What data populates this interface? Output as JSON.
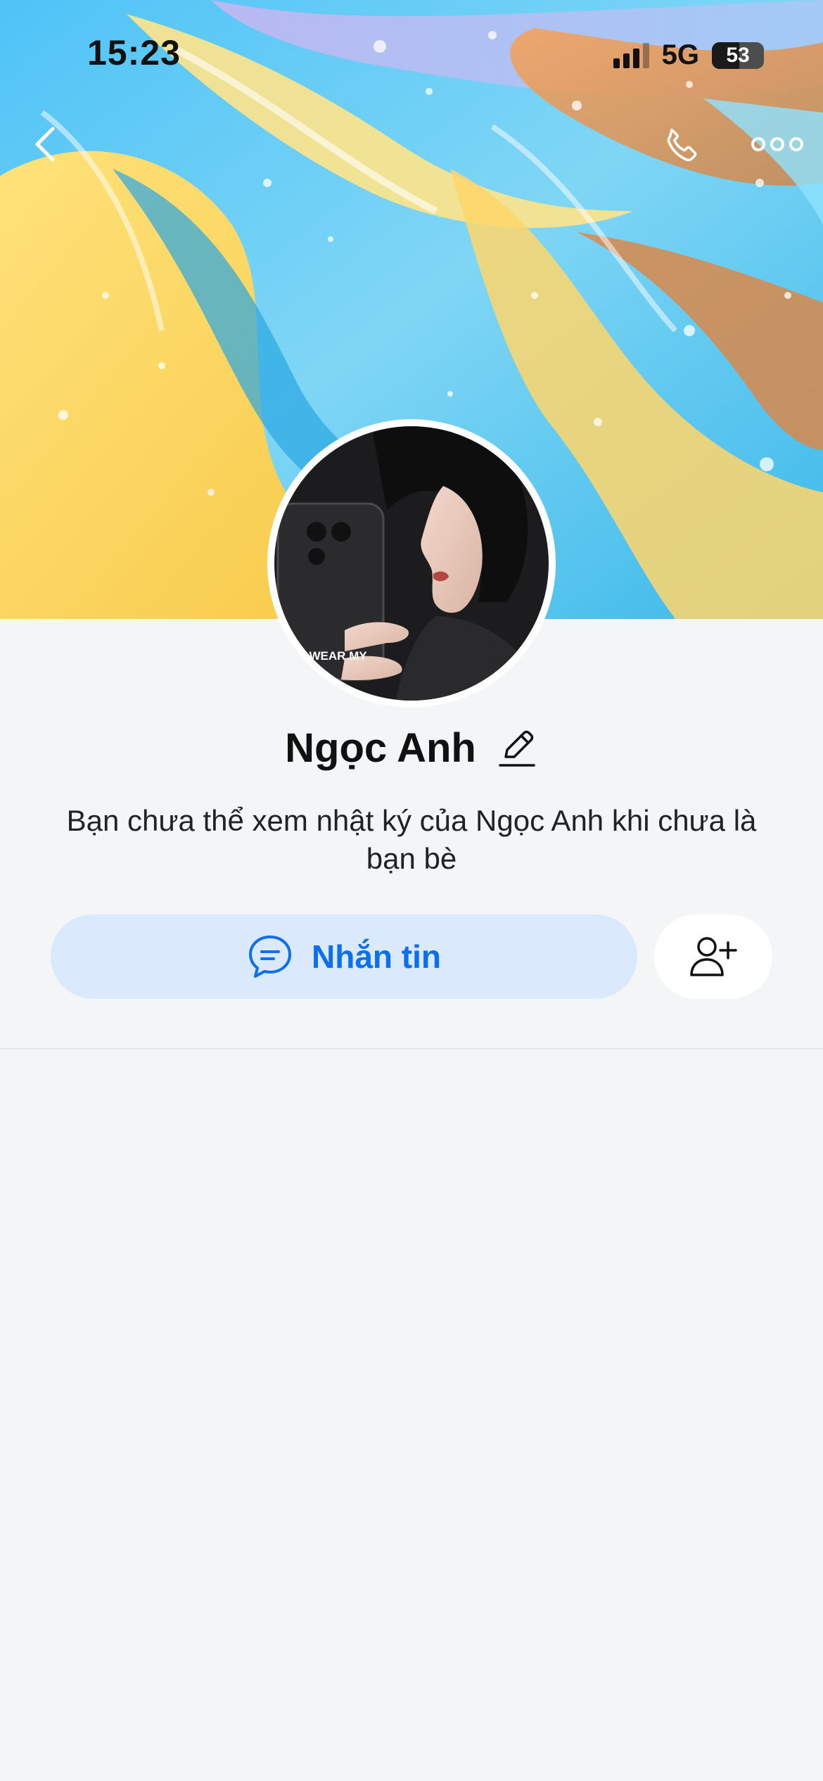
{
  "status_bar": {
    "time": "15:23",
    "network": "5G",
    "battery_percent": "53",
    "battery_level": 0.53,
    "signal_icon": "cellular-signal-icon"
  },
  "nav": {
    "back_icon": "chevron-left-icon",
    "call_icon": "phone-icon",
    "more_icon": "more-horizontal-icon"
  },
  "avatar": {
    "caption_text": "I WEAR MY"
  },
  "profile": {
    "name": "Ngọc Anh",
    "edit_icon": "pencil-icon",
    "notice": "Bạn chưa thể xem nhật ký của Ngọc Anh khi chưa là bạn bè"
  },
  "actions": {
    "message_label": "Nhắn tin",
    "message_icon": "chat-bubble-icon",
    "add_friend_icon": "user-add-icon"
  },
  "colors": {
    "accent": "#0b6ff0",
    "message_button_bg": "#dbe9fd",
    "page_bg": "#f4f5f7"
  }
}
